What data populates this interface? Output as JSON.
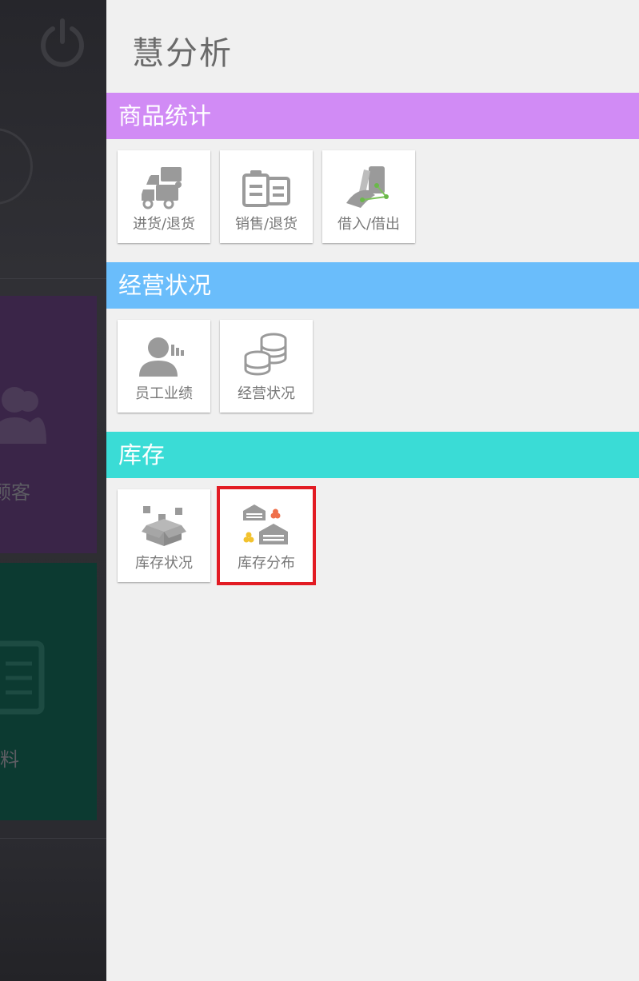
{
  "background_app": {
    "tiles": [
      {
        "label": "顾客"
      },
      {
        "label": "资料"
      }
    ],
    "colors": {
      "purple_tile": "#3a2548",
      "green_tile": "#0c3a31"
    }
  },
  "drawer": {
    "title": "慧分析",
    "sections": [
      {
        "header": "商品统计",
        "color": "#d18bf5",
        "items": [
          {
            "label": "进货/退货",
            "icon": "trucks-icon"
          },
          {
            "label": "销售/退货",
            "icon": "clipboard-icon"
          },
          {
            "label": "借入/借出",
            "icon": "hand-device-icon"
          }
        ]
      },
      {
        "header": "经营状况",
        "color": "#6abdfb",
        "items": [
          {
            "label": "员工业绩",
            "icon": "employee-chart-icon"
          },
          {
            "label": "经营状况",
            "icon": "coin-stack-icon"
          }
        ]
      },
      {
        "header": "库存",
        "color": "#3adcd6",
        "items": [
          {
            "label": "库存状况",
            "icon": "open-box-icon"
          },
          {
            "label": "库存分布",
            "icon": "warehouses-icon",
            "selected": true
          }
        ]
      }
    ]
  }
}
